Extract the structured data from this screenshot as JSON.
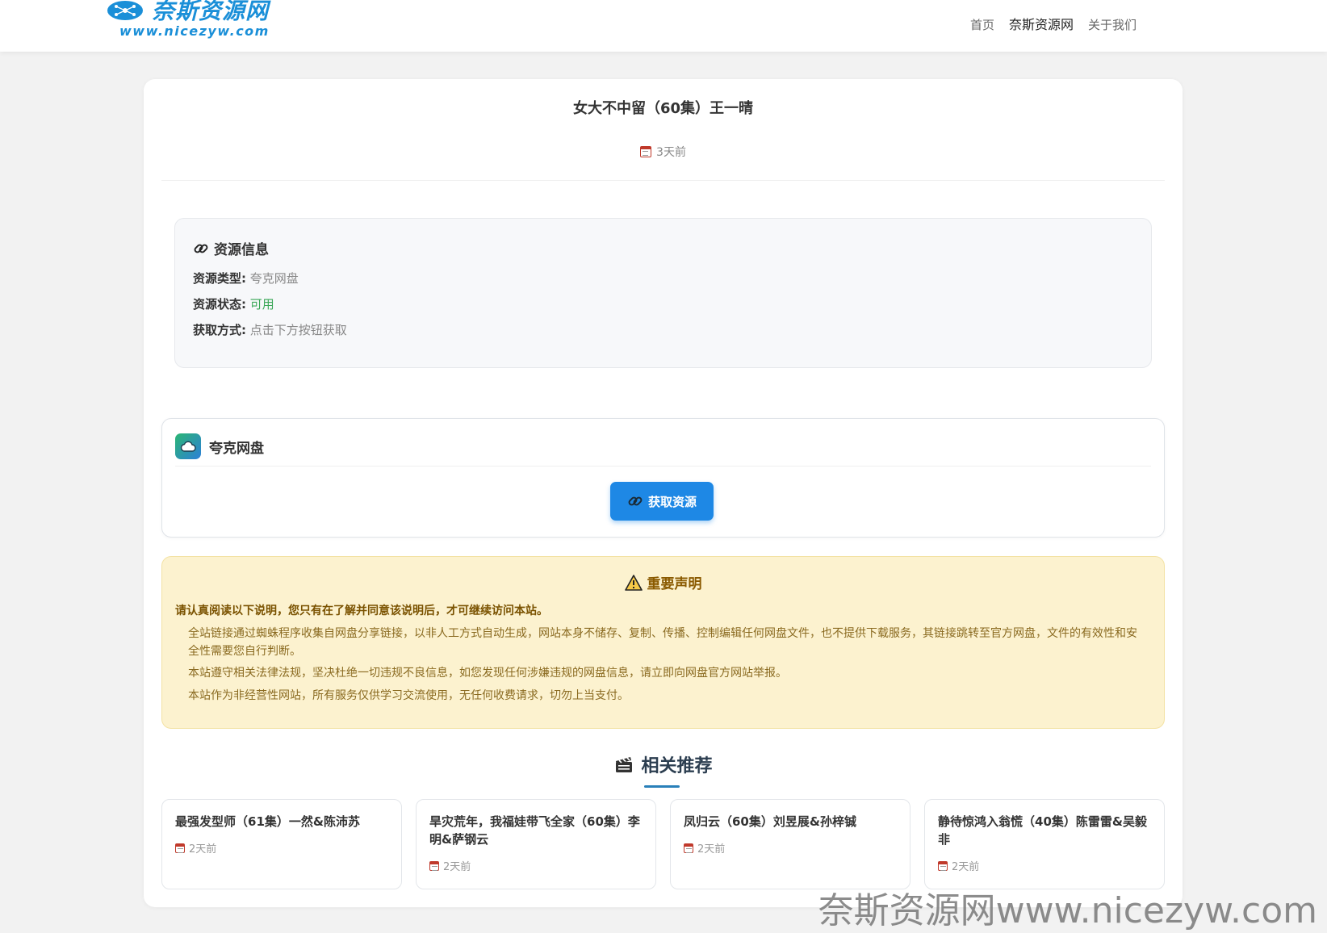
{
  "header": {
    "logo_cn": "奈斯资源网",
    "logo_url": "www.nicezyw.com",
    "nav": [
      {
        "label": "首页"
      },
      {
        "label": "奈斯资源网"
      },
      {
        "label": "关于我们"
      }
    ]
  },
  "post": {
    "title": "女大不中留（60集）王一晴",
    "date": "3天前"
  },
  "resource_info": {
    "heading": "资源信息",
    "rows": [
      {
        "key": "资源类型:",
        "value": "夸克网盘"
      },
      {
        "key": "资源状态:",
        "value": "可用"
      },
      {
        "key": "获取方式:",
        "value": "点击下方按钮获取"
      }
    ]
  },
  "quark": {
    "name": "夸克网盘",
    "button_label": "获取资源"
  },
  "notice": {
    "title": "重要声明",
    "lead": "请认真阅读以下说明，您只有在了解并同意该说明后，才可继续访问本站。",
    "paragraphs": [
      "全站链接通过蜘蛛程序收集自网盘分享链接，以非人工方式自动生成，网站本身不储存、复制、传播、控制编辑任何网盘文件，也不提供下载服务，其链接跳转至官方网盘，文件的有效性和安全性需要您自行判断。",
      "本站遵守相关法律法规，坚决杜绝一切违规不良信息，如您发现任何涉嫌违规的网盘信息，请立即向网盘官方网站举报。",
      "本站作为非经营性网站，所有服务仅供学习交流使用，无任何收费请求，切勿上当支付。"
    ]
  },
  "related": {
    "heading": "相关推荐",
    "items": [
      {
        "title": "最强发型师（61集）一然&陈沛苏",
        "date": "2天前"
      },
      {
        "title": "旱灾荒年，我福娃带飞全家（60集）李明&萨钢云",
        "date": "2天前"
      },
      {
        "title": "凤归云（60集）刘昱展&孙梓铖",
        "date": "2天前"
      },
      {
        "title": "静待惊鸿入翁慌（40集）陈雷雷&吴毅非",
        "date": "2天前"
      }
    ]
  },
  "watermark": "奈斯资源网www.nicezyw.com",
  "colors": {
    "brand": "#1a8fd8",
    "button": "#1e88e5",
    "status_ok": "#3aa757",
    "notice_bg": "#fcf2cf"
  }
}
